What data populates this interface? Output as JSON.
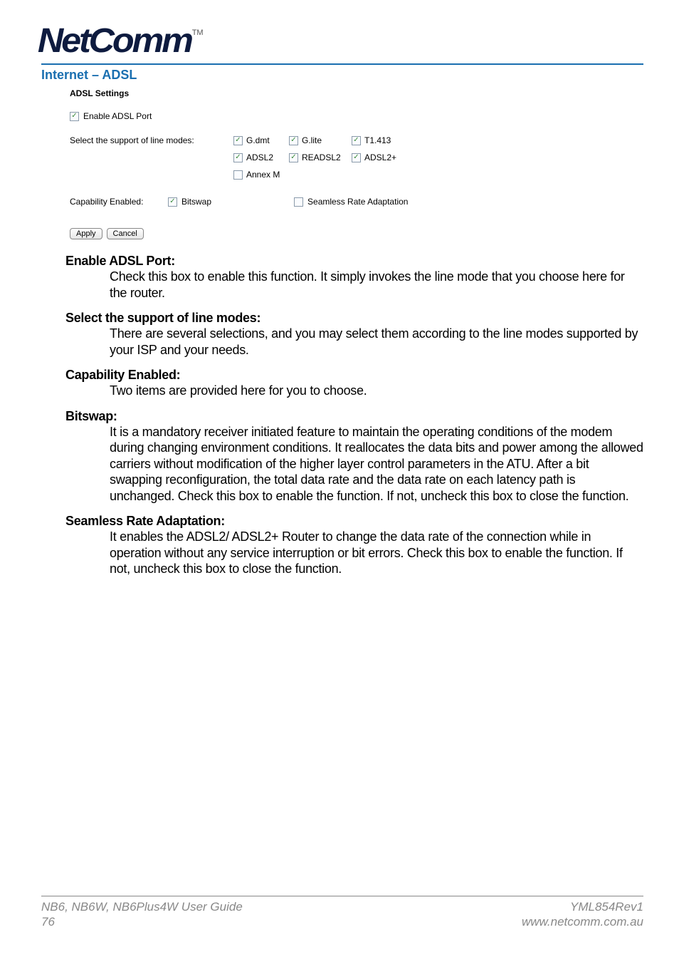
{
  "brand": {
    "name": "NetComm",
    "tm": "TM"
  },
  "section_title": "Internet – ADSL",
  "router": {
    "panel_title": "ADSL Settings",
    "enable_port": {
      "label": "Enable ADSL Port",
      "checked": true
    },
    "line_modes_label": "Select the support of line modes:",
    "modes": {
      "gdmt": {
        "label": "G.dmt",
        "checked": true
      },
      "glite": {
        "label": "G.lite",
        "checked": true
      },
      "t1413": {
        "label": "T1.413",
        "checked": true
      },
      "adsl2": {
        "label": "ADSL2",
        "checked": true
      },
      "readsl2": {
        "label": "READSL2",
        "checked": true
      },
      "adsl2p": {
        "label": "ADSL2+",
        "checked": true
      },
      "annexm": {
        "label": "Annex M",
        "checked": false
      }
    },
    "capability_label": "Capability Enabled:",
    "bitswap": {
      "label": "Bitswap",
      "checked": true
    },
    "sra": {
      "label": "Seamless Rate Adaptation",
      "checked": false
    },
    "apply": "Apply",
    "cancel": "Cancel"
  },
  "desc": {
    "enable_port": {
      "title": "Enable ADSL Port:",
      "body": "Check this box to enable this function. It simply invokes the line mode that you choose here for the router."
    },
    "line_modes": {
      "title": "Select the support of line modes:",
      "body": "There are several selections, and you may select them according to the line modes supported by your ISP and your needs."
    },
    "capability": {
      "title": "Capability Enabled:",
      "body": "Two items are provided here for you to choose."
    },
    "bitswap": {
      "title": "Bitswap:",
      "body": "It is a mandatory receiver initiated feature to maintain the operating conditions of the modem during changing environment conditions. It reallocates the data bits and power among the allowed carriers without modification of the higher layer control parameters in the ATU. After a bit swapping reconfiguration, the total data rate and the data rate on each latency path is unchanged. Check this box to enable the function. If not, uncheck this box to close the function."
    },
    "sra": {
      "title": "Seamless Rate Adaptation:",
      "body": "It enables the ADSL2/ ADSL2+ Router to change the data rate of the connection while in operation without any service interruption or bit errors. Check this box to enable the function. If not, uncheck this box to close the function."
    }
  },
  "footer": {
    "guide": "NB6, NB6W, NB6Plus4W User Guide",
    "page": "76",
    "rev": "YML854Rev1",
    "url": "www.netcomm.com.au"
  }
}
